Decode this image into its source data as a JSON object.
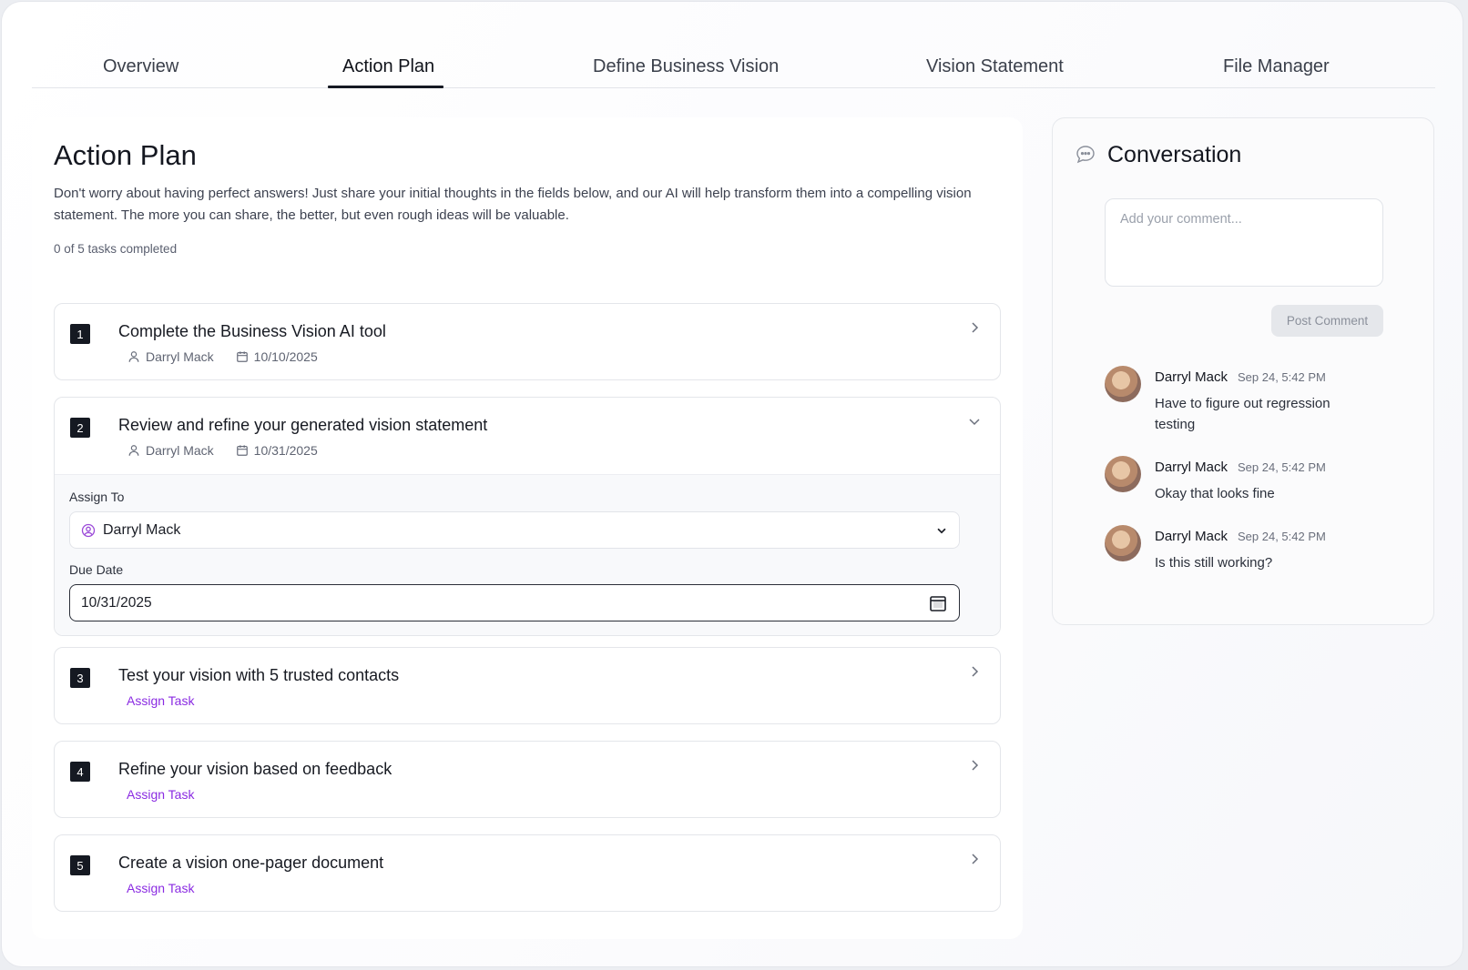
{
  "tabs": [
    {
      "label": "Overview",
      "active": false
    },
    {
      "label": "Action Plan",
      "active": true
    },
    {
      "label": "Define Business Vision",
      "active": false
    },
    {
      "label": "Vision Statement",
      "active": false
    },
    {
      "label": "File Manager",
      "active": false
    }
  ],
  "action_plan": {
    "title": "Action Plan",
    "intro": "Don't worry about having perfect answers! Just share your initial thoughts in the fields below, and our AI will help transform them into a compelling vision statement. The more you can share, the better, but even rough ideas will be valuable.",
    "progress": "0 of 5 tasks completed",
    "tasks": [
      {
        "number": "1",
        "title": "Complete the Business Vision AI tool",
        "assignee": "Darryl Mack",
        "due": "10/10/2025",
        "expanded": false
      },
      {
        "number": "2",
        "title": "Review and refine your generated vision statement",
        "assignee": "Darryl Mack",
        "due": "10/31/2025",
        "expanded": true
      },
      {
        "number": "3",
        "title": "Test your vision with 5 trusted contacts",
        "assign_label": "Assign Task",
        "expanded": false
      },
      {
        "number": "4",
        "title": "Refine your vision based on feedback",
        "assign_label": "Assign Task",
        "expanded": false
      },
      {
        "number": "5",
        "title": "Create a vision one-pager document",
        "assign_label": "Assign Task",
        "expanded": false
      }
    ],
    "expanded_form": {
      "assign_to_label": "Assign To",
      "assign_to_value": "Darryl Mack",
      "due_date_label": "Due Date",
      "due_date_value": "10/31/2025"
    }
  },
  "conversation": {
    "title": "Conversation",
    "comment_placeholder": "Add your comment...",
    "post_button": "Post Comment",
    "comments": [
      {
        "author": "Darryl Mack",
        "time": "Sep 24, 5:42 PM",
        "text": "Have to figure out regression testing"
      },
      {
        "author": "Darryl Mack",
        "time": "Sep 24, 5:42 PM",
        "text": "Okay that looks fine"
      },
      {
        "author": "Darryl Mack",
        "time": "Sep 24, 5:42 PM",
        "text": "Is this still working?"
      }
    ]
  },
  "colors": {
    "accent_purple": "#8a2be2",
    "dark": "#151922",
    "muted_button": "#e5e7eb"
  },
  "icons": {
    "person": "user-icon",
    "calendar": "calendar-icon",
    "chevron_right": "chevron-right-icon",
    "chevron_down": "chevron-down-icon",
    "chat": "chat-bubble-icon"
  }
}
